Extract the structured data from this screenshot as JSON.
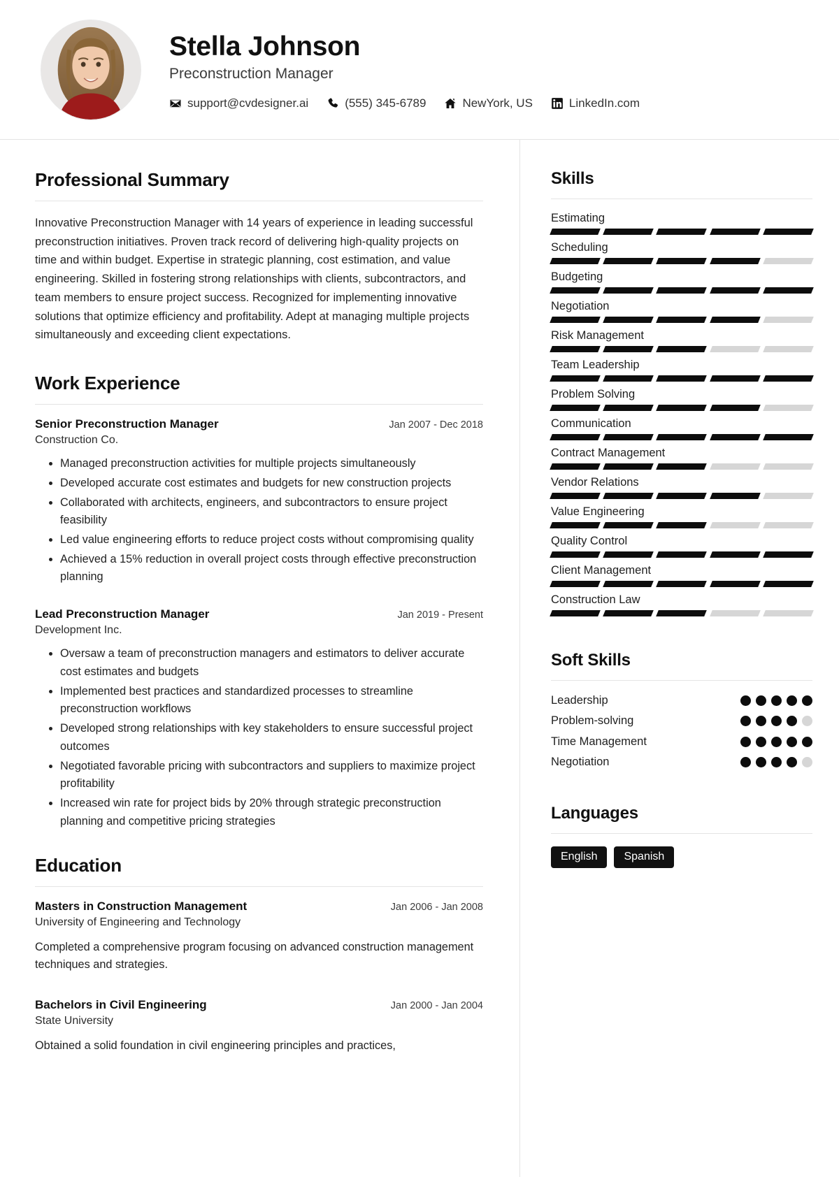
{
  "header": {
    "name": "Stella Johnson",
    "role": "Preconstruction Manager",
    "contacts": [
      {
        "icon": "envelope-icon",
        "text": "support@cvdesigner.ai"
      },
      {
        "icon": "phone-icon",
        "text": "(555) 345-6789"
      },
      {
        "icon": "home-icon",
        "text": "NewYork, US"
      },
      {
        "icon": "linkedin-icon",
        "text": "LinkedIn.com"
      }
    ]
  },
  "summary": {
    "title": "Professional Summary",
    "text": "Innovative Preconstruction Manager with 14 years of experience in leading successful preconstruction initiatives. Proven track record of delivering high-quality projects on time and within budget. Expertise in strategic planning, cost estimation, and value engineering. Skilled in fostering strong relationships with clients, subcontractors, and team members to ensure project success. Recognized for implementing innovative solutions that optimize efficiency and profitability. Adept at managing multiple projects simultaneously and exceeding client expectations."
  },
  "experience": {
    "title": "Work Experience",
    "items": [
      {
        "title": "Senior Preconstruction Manager",
        "date": "Jan 2007 - Dec 2018",
        "company": "Construction Co.",
        "bullets": [
          "Managed preconstruction activities for multiple projects simultaneously",
          "Developed accurate cost estimates and budgets for new construction projects",
          "Collaborated with architects, engineers, and subcontractors to ensure project feasibility",
          "Led value engineering efforts to reduce project costs without compromising quality",
          "Achieved a 15% reduction in overall project costs through effective preconstruction planning"
        ]
      },
      {
        "title": "Lead Preconstruction Manager",
        "date": "Jan 2019 - Present",
        "company": "Development Inc.",
        "bullets": [
          "Oversaw a team of preconstruction managers and estimators to deliver accurate cost estimates and budgets",
          "Implemented best practices and standardized processes to streamline preconstruction workflows",
          "Developed strong relationships with key stakeholders to ensure successful project outcomes",
          "Negotiated favorable pricing with subcontractors and suppliers to maximize project profitability",
          "Increased win rate for project bids by 20% through strategic preconstruction planning and competitive pricing strategies"
        ]
      }
    ]
  },
  "education": {
    "title": "Education",
    "items": [
      {
        "title": "Masters in Construction Management",
        "date": "Jan 2006 - Jan 2008",
        "school": "University of Engineering and Technology",
        "description": "Completed a comprehensive program focusing on advanced construction management techniques and strategies."
      },
      {
        "title": "Bachelors in Civil Engineering",
        "date": "Jan 2000 - Jan 2004",
        "school": "State University",
        "description": "Obtained a solid foundation in civil engineering principles and practices,"
      }
    ]
  },
  "skills": {
    "title": "Skills",
    "segments_total": 5,
    "items": [
      {
        "name": "Estimating",
        "filled": 5
      },
      {
        "name": "Scheduling",
        "filled": 4
      },
      {
        "name": "Budgeting",
        "filled": 5
      },
      {
        "name": "Negotiation",
        "filled": 4
      },
      {
        "name": "Risk Management",
        "filled": 3
      },
      {
        "name": "Team Leadership",
        "filled": 5
      },
      {
        "name": "Problem Solving",
        "filled": 4
      },
      {
        "name": "Communication",
        "filled": 5
      },
      {
        "name": "Contract Management",
        "filled": 3
      },
      {
        "name": "Vendor Relations",
        "filled": 4
      },
      {
        "name": "Value Engineering",
        "filled": 3
      },
      {
        "name": "Quality Control",
        "filled": 5
      },
      {
        "name": "Client Management",
        "filled": 5
      },
      {
        "name": "Construction Law",
        "filled": 3
      }
    ]
  },
  "soft_skills": {
    "title": "Soft Skills",
    "dots_total": 5,
    "items": [
      {
        "name": "Leadership",
        "filled": 5
      },
      {
        "name": "Problem-solving",
        "filled": 4
      },
      {
        "name": "Time Management",
        "filled": 5
      },
      {
        "name": "Negotiation",
        "filled": 4
      }
    ]
  },
  "languages": {
    "title": "Languages",
    "items": [
      "English",
      "Spanish"
    ]
  },
  "colors": {
    "accent": "#0d0d0d",
    "muted": "#d6d6d6",
    "rule": "#e4e4e4"
  }
}
